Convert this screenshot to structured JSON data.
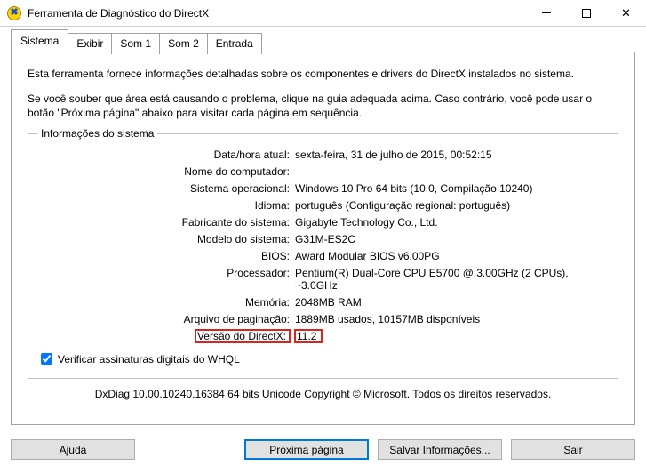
{
  "window": {
    "title": "Ferramenta de Diagnóstico do DirectX"
  },
  "tabs": {
    "t0": "Sistema",
    "t1": "Exibir",
    "t2": "Som 1",
    "t3": "Som 2",
    "t4": "Entrada"
  },
  "intro": {
    "p1": "Esta ferramenta fornece informações detalhadas sobre os componentes e drivers do DirectX instalados no sistema.",
    "p2": "Se você souber que área está causando o problema, clique na guia adequada acima. Caso contrário, você pode usar o botão \"Próxima página\" abaixo para visitar cada página em sequência."
  },
  "group": {
    "legend": "Informações do sistema",
    "rows": {
      "r0": {
        "label": "Data/hora atual:",
        "value": "sexta-feira, 31 de julho de 2015, 00:52:15"
      },
      "r1": {
        "label": "Nome do computador:",
        "value": ""
      },
      "r2": {
        "label": "Sistema operacional:",
        "value": "Windows 10 Pro 64 bits (10.0, Compilação 10240)"
      },
      "r3": {
        "label": "Idioma:",
        "value": "português (Configuração regional: português)"
      },
      "r4": {
        "label": "Fabricante do sistema:",
        "value": "Gigabyte Technology Co., Ltd."
      },
      "r5": {
        "label": "Modelo do sistema:",
        "value": "G31M-ES2C"
      },
      "r6": {
        "label": "BIOS:",
        "value": "Award Modular BIOS v6.00PG"
      },
      "r7": {
        "label": "Processador:",
        "value": "Pentium(R) Dual-Core  CPU      E5700  @ 3.00GHz (2 CPUs), ~3.0GHz"
      },
      "r8": {
        "label": "Memória:",
        "value": "2048MB RAM"
      },
      "r9": {
        "label": "Arquivo de paginação:",
        "value": "1889MB usados, 10157MB disponíveis"
      },
      "r10": {
        "label": "Versão do DirectX:",
        "value": "11.2"
      }
    },
    "checkbox": "Verificar assinaturas digitais do WHQL"
  },
  "footer": "DxDiag 10.00.10240.16384 64 bits Unicode  Copyright © Microsoft. Todos os direitos reservados.",
  "buttons": {
    "help": "Ajuda",
    "next": "Próxima página",
    "save": "Salvar Informações...",
    "exit": "Sair"
  }
}
